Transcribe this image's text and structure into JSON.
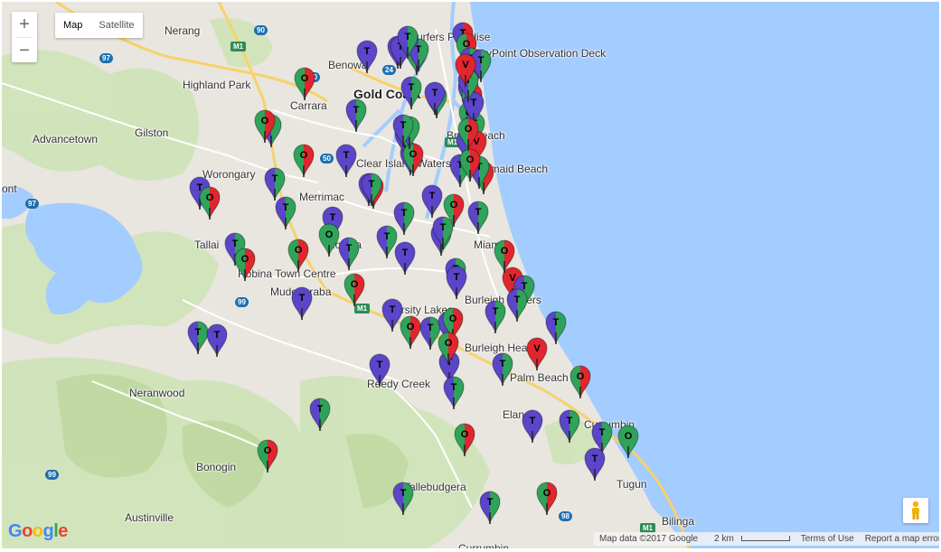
{
  "controls": {
    "zoom_in": "+",
    "zoom_out": "−",
    "map_label": "Map",
    "satellite_label": "Satellite"
  },
  "logo": "Google",
  "footer": {
    "map_data": "Map data ©2017 Google",
    "scale": "2 km",
    "terms": "Terms of Use",
    "report": "Report a map error"
  },
  "colors": {
    "T": "#5b45c8",
    "O": "#2fa35a",
    "V": "#e0262e",
    "water": "#a3ccff",
    "land": "#e8e6df"
  },
  "places": [
    {
      "name": "Nerang",
      "cls": "med"
    },
    {
      "name": "Surfers Paradise",
      "cls": "med"
    },
    {
      "name": "SkyPoint Observation Deck",
      "cls": "med"
    },
    {
      "name": "Benowa",
      "cls": "med"
    },
    {
      "name": "Highland Park",
      "cls": "med"
    },
    {
      "name": "Gold Coast",
      "cls": "big"
    },
    {
      "name": "Carrara",
      "cls": "med"
    },
    {
      "name": "Advancetown",
      "cls": "med"
    },
    {
      "name": "Gilston",
      "cls": "med"
    },
    {
      "name": "Broadbeach",
      "cls": "med"
    },
    {
      "name": "Worongary",
      "cls": "med"
    },
    {
      "name": "Clear Island Waters",
      "cls": "med"
    },
    {
      "name": "Mermaid Beach",
      "cls": "med"
    },
    {
      "name": "Merrimac",
      "cls": "med"
    },
    {
      "name": "Tallai",
      "cls": "med"
    },
    {
      "name": "Robina",
      "cls": "med"
    },
    {
      "name": "Miami",
      "cls": "med"
    },
    {
      "name": "Robina Town Centre",
      "cls": "med"
    },
    {
      "name": "Mudgeeraba",
      "cls": "med"
    },
    {
      "name": "Varsity Lakes",
      "cls": "med"
    },
    {
      "name": "Burleigh Waters",
      "cls": "med"
    },
    {
      "name": "Burleigh Heads",
      "cls": "med"
    },
    {
      "name": "Palm Beach",
      "cls": "med"
    },
    {
      "name": "Neranwood",
      "cls": "med"
    },
    {
      "name": "Reedy Creek",
      "cls": "med"
    },
    {
      "name": "Elanora",
      "cls": "med"
    },
    {
      "name": "Currumbin",
      "cls": "med"
    },
    {
      "name": "Bonogin",
      "cls": "med"
    },
    {
      "name": "Tugun",
      "cls": "med"
    },
    {
      "name": "Tallebudgera",
      "cls": "med"
    },
    {
      "name": "Austinville",
      "cls": "med"
    },
    {
      "name": "Bilinga",
      "cls": "med"
    },
    {
      "name": "Currumbin",
      "cls": "med"
    },
    {
      "name": "ont",
      "cls": "med"
    }
  ],
  "shields": [
    "M1",
    "M1",
    "M1",
    "M1",
    "90",
    "97",
    "97",
    "99",
    "99",
    "98",
    "50",
    "24",
    "90"
  ],
  "markers": [
    [
      "T",
      null
    ],
    [
      "T",
      "O"
    ],
    [
      "O",
      "V"
    ],
    [
      "T",
      "O"
    ],
    [
      "T",
      "V"
    ],
    [
      "O",
      "V"
    ],
    [
      "T",
      "O"
    ],
    [
      "T",
      null
    ],
    [
      "T",
      "O"
    ],
    [
      "T",
      "O"
    ],
    [
      "O",
      "V"
    ],
    [
      "T",
      "O"
    ],
    [
      "T",
      "O"
    ],
    [
      "T",
      null
    ],
    [
      "T",
      "O"
    ],
    [
      "T",
      "O"
    ],
    [
      "T",
      "O"
    ],
    [
      "O",
      "V"
    ],
    [
      "T",
      "O"
    ],
    [
      "O",
      "V"
    ],
    [
      "T",
      null
    ],
    [
      "O",
      "V"
    ],
    [
      "T",
      "O"
    ],
    [
      "T",
      "O"
    ],
    [
      "T",
      null
    ],
    [
      "O",
      "V"
    ],
    [
      "T",
      "O"
    ],
    [
      "T",
      null
    ],
    [
      "T",
      "O"
    ],
    [
      "O",
      "V"
    ],
    [
      "T",
      "O"
    ],
    [
      "T",
      null
    ],
    [
      "O",
      null
    ],
    [
      "T",
      "O"
    ],
    [
      "T",
      "O"
    ],
    [
      "T",
      null
    ],
    [
      "T",
      "O"
    ],
    [
      "O",
      "V"
    ],
    [
      "T",
      "O"
    ],
    [
      "T",
      "O"
    ],
    [
      "O",
      "V"
    ],
    [
      "T",
      "O"
    ],
    [
      "O",
      "V"
    ],
    [
      "T",
      "O"
    ],
    [
      "O",
      "V"
    ],
    [
      "T",
      null
    ],
    [
      "O",
      "V"
    ],
    [
      "T",
      "O"
    ],
    [
      "T",
      null
    ],
    [
      "T",
      null
    ],
    [
      "O",
      "V"
    ],
    [
      "T",
      "O"
    ],
    [
      "T",
      "O"
    ],
    [
      "O",
      "V"
    ],
    [
      "T",
      "O"
    ],
    [
      "V",
      null
    ],
    [
      "T",
      "O"
    ],
    [
      "T",
      "O"
    ],
    [
      "O",
      "V"
    ],
    [
      "T",
      "O"
    ],
    [
      "V",
      null
    ],
    [
      "O",
      "V"
    ],
    [
      "T",
      "O"
    ],
    [
      "T",
      null
    ],
    [
      "T",
      "O"
    ],
    [
      "O",
      "V"
    ],
    [
      "T",
      null
    ],
    [
      "T",
      null
    ],
    [
      "T",
      "O"
    ],
    [
      "O",
      "V"
    ],
    [
      "T",
      "O"
    ],
    [
      "O",
      null
    ],
    [
      "T",
      null
    ],
    [
      "T",
      "O"
    ],
    [
      "T",
      null
    ],
    [
      "T",
      "O"
    ],
    [
      "O",
      "V"
    ],
    [
      "T",
      "O"
    ],
    [
      "T",
      "O"
    ],
    [
      "O",
      "V"
    ],
    [
      "T",
      "O"
    ],
    [
      "T",
      null
    ],
    [
      "O",
      "V"
    ],
    [
      "T",
      "O"
    ],
    [
      "O",
      "V"
    ],
    [
      "T",
      "O"
    ],
    [
      "T",
      null
    ],
    [
      "T",
      "O"
    ],
    [
      "V",
      null
    ],
    [
      "V",
      null
    ],
    [
      "T",
      "O"
    ],
    [
      "O",
      "V"
    ],
    [
      "T",
      "O"
    ],
    [
      "T",
      "O"
    ],
    [
      "O",
      "V"
    ],
    [
      "T",
      "O"
    ],
    [
      "T",
      "O"
    ],
    [
      "O",
      "V"
    ],
    [
      "T",
      "O"
    ]
  ]
}
